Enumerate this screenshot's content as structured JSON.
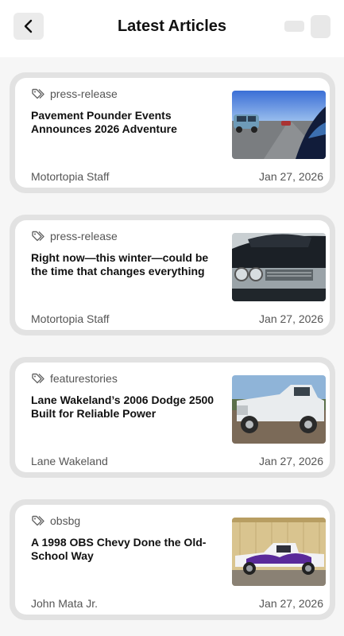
{
  "header": {
    "title": "Latest Articles",
    "back_icon": "chevron-left-icon"
  },
  "articles": [
    {
      "tag": "press-release",
      "title": "Pavement Pounder Events Announces 2026 Adventure",
      "author": "Motortopia Staff",
      "date": "Jan 27, 2026",
      "image": "blue-pickup-on-highway"
    },
    {
      "tag": "press-release",
      "title": "Right now—this winter—could be the time that changes everything",
      "author": "Motortopia Staff",
      "date": "Jan 27, 2026",
      "image": "covered-classic-car-front"
    },
    {
      "tag": "featurestories",
      "title": "Lane Wakeland’s 2006 Dodge 2500 Built for Reliable Power",
      "author": "Lane Wakeland",
      "date": "Jan 27, 2026",
      "image": "white-dodge-pickup"
    },
    {
      "tag": "obsbg",
      "title": "A 1998 OBS Chevy Done the Old-School Way",
      "author": "John Mata Jr.",
      "date": "Jan 27, 2026",
      "image": "purple-flame-chevy-truck"
    }
  ]
}
